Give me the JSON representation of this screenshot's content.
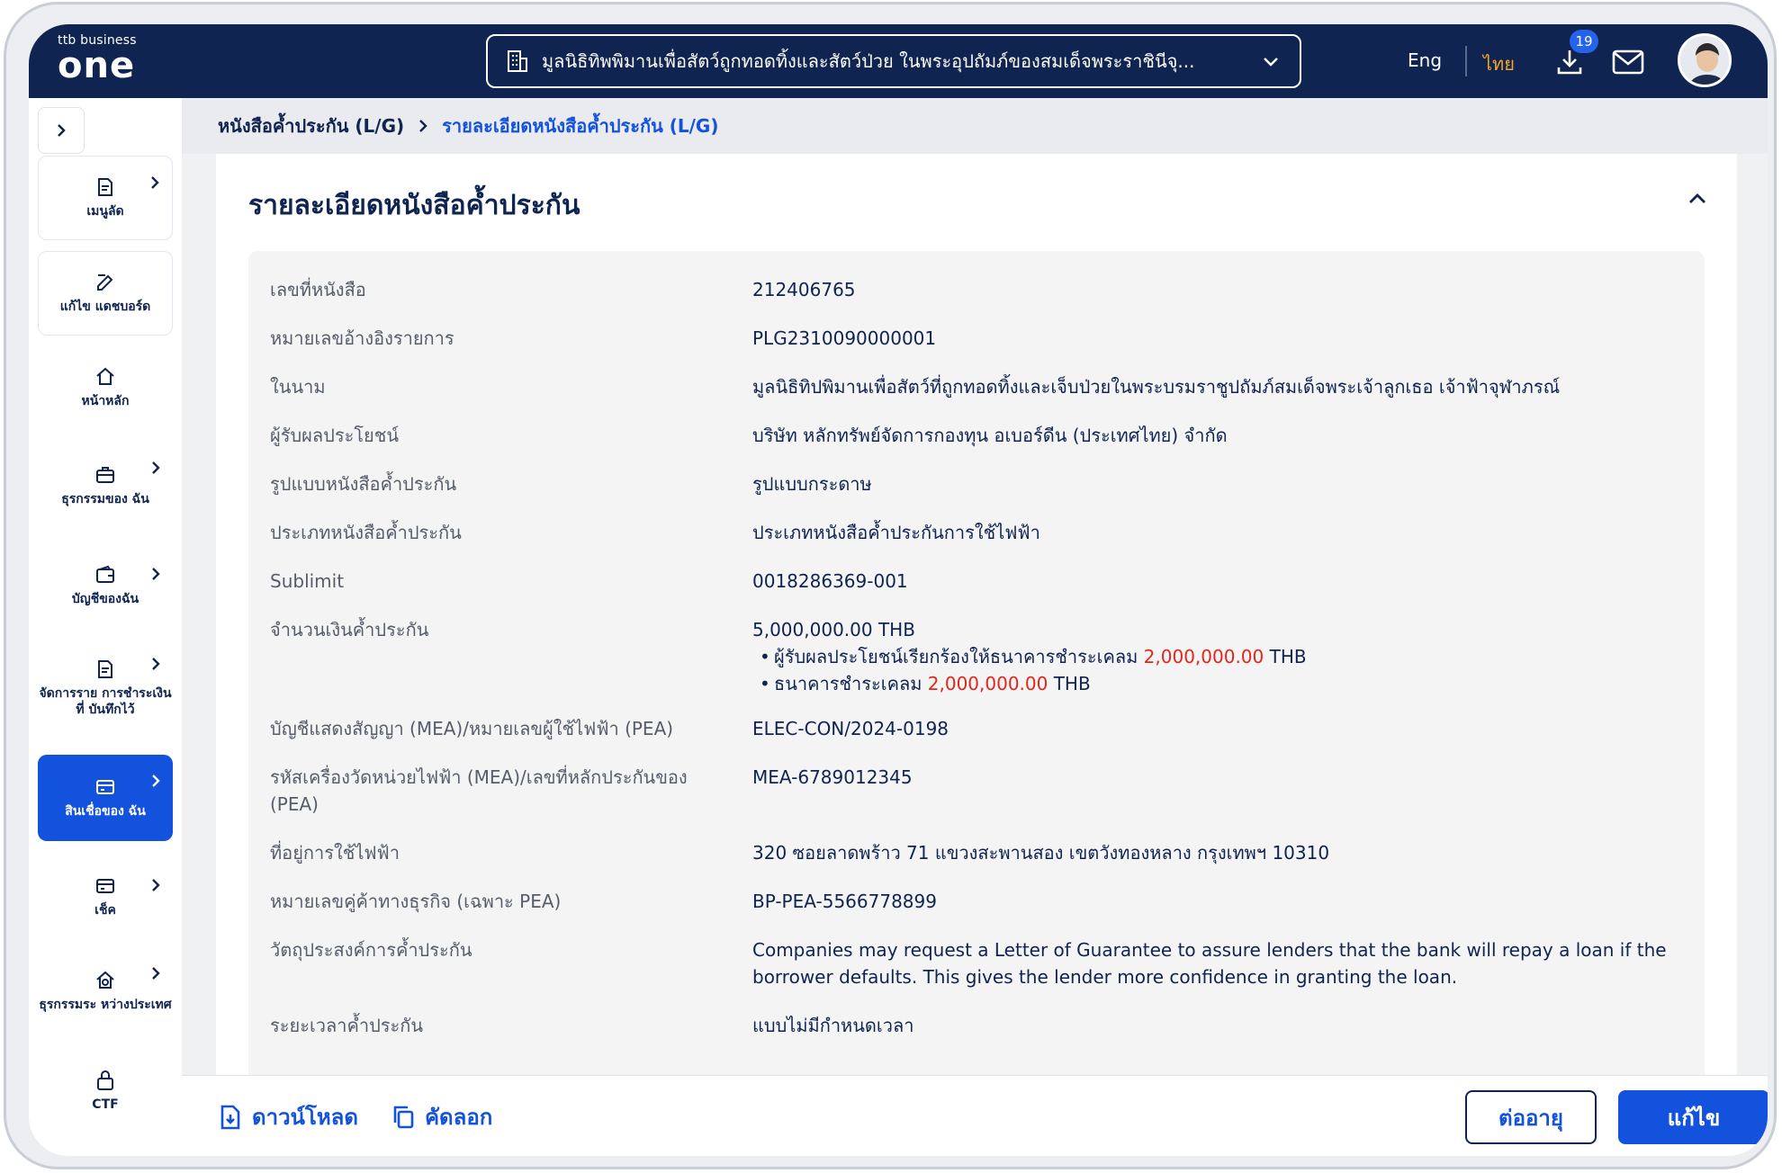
{
  "brand": {
    "small": "ttb business",
    "big": "one"
  },
  "header": {
    "company_name": "มูลนิธิทิพพิมานเพื่อสัตว์ถูกทอดทิ้งและสัตว์ป่วย ในพระอุปถัมภ์ของสมเด็จพระราชินีจุ...",
    "lang_en": "Eng",
    "lang_th": "ไทย",
    "download_badge": "19"
  },
  "sidebar": {
    "items": [
      {
        "label": "เมนูลัด"
      },
      {
        "label": "แก้ไข แดชบอร์ด"
      },
      {
        "label": "หน้าหลัก"
      },
      {
        "label": "ธุรกรรมของ ฉัน"
      },
      {
        "label": "บัญชีของฉัน"
      },
      {
        "label": "จัดการราย การชำระเงินที่ บันทึกไว้"
      },
      {
        "label": "สินเชื่อของ ฉัน"
      },
      {
        "label": "เช็ค"
      },
      {
        "label": "ธุรกรรมระ หว่างประเทศ"
      },
      {
        "label": "CTF"
      }
    ]
  },
  "breadcrumb": {
    "parent": "หนังสือค้ำประกัน (L/G)",
    "current": "รายละเอียดหนังสือค้ำประกัน (L/G)"
  },
  "panel": {
    "title": "รายละเอียดหนังสือค้ำประกัน",
    "rows": [
      {
        "label": "เลขที่หนังสือ",
        "value": "212406765"
      },
      {
        "label": "หมายเลขอ้างอิงรายการ",
        "value": "PLG2310090000001"
      },
      {
        "label": "ในนาม",
        "value": "มูลนิธิทิปพิมานเพื่อสัตว์ที่ถูกทอดทิ้งและเจ็บป่วยในพระบรมราชูปถัมภ์สมเด็จพระเจ้าลูกเธอ เจ้าฟ้าจุฬาภรณ์"
      },
      {
        "label": "ผู้รับผลประโยชน์",
        "value": "บริษัท หลักทรัพย์จัดการกองทุน อเบอร์ดีน (ประเทศไทย) จำกัด"
      },
      {
        "label": "รูปแบบหนังสือค้ำประกัน",
        "value": "รูปแบบกระดาษ"
      },
      {
        "label": "ประเภทหนังสือค้ำประกัน",
        "value": "ประเภทหนังสือค้ำประกันการใช้ไฟฟ้า"
      },
      {
        "label": "Sublimit",
        "value": "0018286369-001"
      },
      {
        "label": "จำนวนเงินค้ำประกัน",
        "value": "5,000,000.00 THB"
      },
      {
        "label": "บัญชีแสดงสัญญา (MEA)/หมายเลขผู้ใช้ไฟฟ้า (PEA)",
        "value": "ELEC-CON/2024-0198"
      },
      {
        "label": "รหัสเครื่องวัดหน่วยไฟฟ้า (MEA)/เลขที่หลักประกันของ (PEA)",
        "value": "MEA-6789012345"
      },
      {
        "label": "ที่อยู่การใช้ไฟฟ้า",
        "value": "320 ซอยลาดพร้าว 71 แขวงสะพานสอง เขตวังทองหลาง กรุงเทพฯ 10310"
      },
      {
        "label": "หมายเลขคู่ค้าทางธุรกิจ (เฉพาะ PEA)",
        "value": "BP-PEA-5566778899"
      },
      {
        "label": "วัตถุประสงค์การค้ำประกัน",
        "value": "Companies may request a Letter of Guarantee to assure lenders that the bank will repay a loan if the borrower defaults. This gives the lender more confidence in granting the loan."
      },
      {
        "label": "ระยะเวลาค้ำประกัน",
        "value": "แบบไม่มีกำหนดเวลา"
      }
    ],
    "amount_bullets": [
      {
        "text": "ผู้รับผลประโยชน์เรียกร้องให้ธนาคารชำระเคลม",
        "amount": "2,000,000.00",
        "currency": "THB"
      },
      {
        "text": "ธนาคารชำระเคลม",
        "amount": "2,000,000.00",
        "currency": "THB"
      }
    ]
  },
  "footer": {
    "download": "ดาวน์โหลด",
    "copy": "คัดลอก",
    "renew": "ต่ออายุ",
    "edit": "แก้ไข"
  },
  "colors": {
    "navy": "#0f2450",
    "primary": "#1352dd",
    "accent": "#f5a623",
    "red": "#e1261c"
  }
}
